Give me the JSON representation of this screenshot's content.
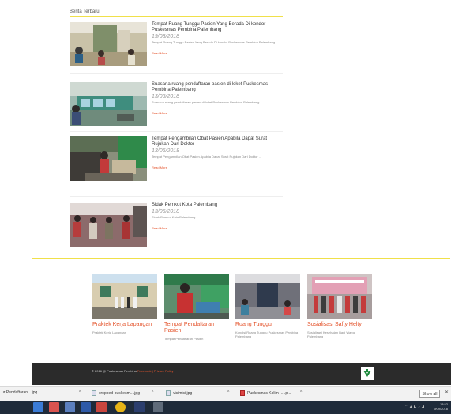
{
  "news": {
    "heading": "Berita Terbaru",
    "items": [
      {
        "title": "Tempat Ruang Tunggu Pasien Yang Berada Di kondor Puskesmas Pembina Palembang",
        "date": "19/08/2018",
        "excerpt": "Tempat Ruang Tunggu Pasien Yang Berada Di kondor Puskesmas Pembina Palembang ...",
        "read_more": "Read More"
      },
      {
        "title": "Suasana ruang pendaftaran pasien di loket Puskesmas Pembina Palembang",
        "date": "13/06/2018",
        "excerpt": "Suasana ruang pendaftaran pasien di loket Puskesmas Pembina Palembang ...",
        "read_more": "Read More"
      },
      {
        "title": "Tempat Pengambilan Obat Pasien Apabila Dapat Surat Rujukan Dari Doktor",
        "date": "13/06/2018",
        "excerpt": "Tempat Pengambilan Obat Pasien Apabila Dapat Surat Rujukan Dari Doktor ...",
        "read_more": "Read More"
      },
      {
        "title": "Sidak Pemkot Kota Palembang",
        "date": "13/06/2018",
        "excerpt": "Sidak Pemkot Kota Palembang ...",
        "read_more": "Read More"
      }
    ]
  },
  "gallery": [
    {
      "title": "Praktek Kerja Lapangan",
      "desc": "Praktek Kerja Lapangan"
    },
    {
      "title": "Tempat Pendaftaran Pasien",
      "desc": "Tempat Pendaftaran Pasien"
    },
    {
      "title": "Ruang Tunggu",
      "desc": "Kondisi Ruang Tunggu Puskesmas Pembina Palembang"
    },
    {
      "title": "Sosialisasi Safty Helty",
      "desc": "Sosialisasi Kesehatan Bagi Warga Palembang"
    }
  ],
  "footer": {
    "copyright": "© 2016 @ Puskesmas Pembina",
    "links": "Facebook | Privacy Policy"
  },
  "downloads": {
    "items": [
      "ur Pendaftaran ...jpg",
      "cropped-puskesm....jpg",
      "visimisi.jpg",
      "Puskesmas Kolim -....p..."
    ],
    "show_all": "Show all",
    "close": "✕"
  },
  "taskbar": {
    "time": "13:52",
    "date": "9/09/2018"
  },
  "colors": {
    "accent": "#e4542c",
    "divider": "#f0e04a",
    "footer_bg": "#2b2b2b"
  }
}
